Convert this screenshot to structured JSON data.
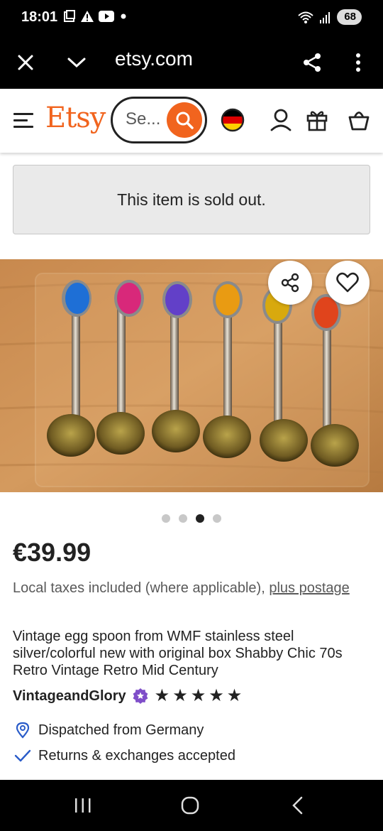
{
  "status_bar": {
    "time": "18:01",
    "battery": "68",
    "icons": [
      "screenshot-icon",
      "alert-icon",
      "youtube-icon",
      "dot-icon",
      "wifi-icon",
      "signal-icon"
    ]
  },
  "browser": {
    "url": "etsy.com",
    "close_icon": "close-icon",
    "dropdown_icon": "chevron-down-icon",
    "share_icon": "share-icon",
    "menu_icon": "more-vertical-icon"
  },
  "header": {
    "logo": "Etsy",
    "search_placeholder": "Se...",
    "brand_color": "#f1641e"
  },
  "notice": {
    "sold_out": "This item is sold out."
  },
  "gallery": {
    "image_count": 4,
    "active_index": 2
  },
  "listing": {
    "price": "€39.99",
    "taxes_text": "Local taxes included (where applicable), ",
    "taxes_link": "plus postage",
    "title": "Vintage egg spoon from WMF stainless steel silver/colorful new with original box Shabby Chic 70s Retro Vintage Retro Mid Century",
    "shop_name": "VintageandGlory",
    "rating_stars": 5,
    "features": [
      {
        "icon": "location-pin-icon",
        "text": "Dispatched from Germany"
      },
      {
        "icon": "checkmark-icon",
        "text": "Returns & exchanges accepted"
      }
    ]
  }
}
